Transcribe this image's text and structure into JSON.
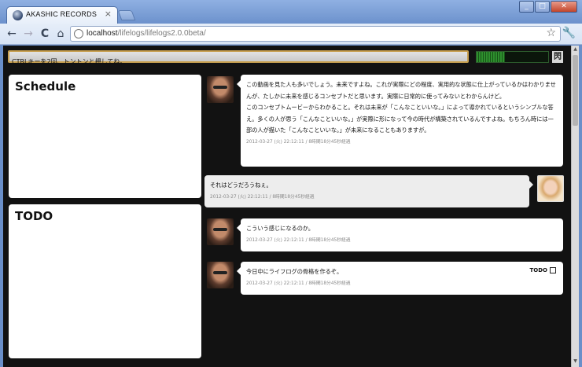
{
  "browser": {
    "tab_title": "AKASHIC RECORDS",
    "tab_close": "×",
    "url_host": "localhost",
    "url_path": "/lifelogs/lifelogs2.0.0beta/",
    "back_icon": "←",
    "forward_icon": "→",
    "reload_icon": "C",
    "home_icon": "⌂",
    "star_icon": "☆",
    "wrench_icon": "🔧",
    "min_icon": "_",
    "max_icon": "□",
    "close_icon": "✕"
  },
  "command_bar": {
    "value": "CTRLキーを2回、トントンと押してね。"
  },
  "meter": {
    "level": 0.4,
    "icon": "閃"
  },
  "schedule": {
    "title": "Schedule"
  },
  "todo": {
    "title": "TODO"
  },
  "messages": [
    {
      "text": "この動画を見た人も多いでしょう。未来ですよね。これが実際にどの程度、実用的な状態に仕上がっているかはわかりませんが、たしかに未来を感じるコンセプトだと思います。実際に日常的に使ってみないとわからんけど。\nこのコンセプトムービーからわかること。それは未来が「こんなこといいな。」によって導かれているというシンプルな答え。多くの人が思う「こんなこといいな。」が実際に形になって今の時代が構築されているんですよね。もちろん時には一部の人が描いた「こんなこといいな。」が未来になることもありますが。",
      "meta": "2012-03-27 (火) 22:12:11 / 8時間18分45秒経過"
    },
    {
      "text": "それはどうだろうねぇ。",
      "meta": "2012-03-27 (火) 22:12:11 / 8時間18分45秒経過"
    },
    {
      "text": "こういう感じになるのか。",
      "meta": "2012-03-27 (火) 22:12:11 / 8時間18分45秒経過"
    },
    {
      "text": "今日中にライフログの骨格を作るぞ。",
      "meta": "2012-03-27 (火) 22:12:11 / 8時間18分45秒経過",
      "tag": "TODO"
    }
  ],
  "colors": {
    "page_bg": "#121212",
    "accent_border": "#c8a050",
    "meter_green": "#2e8f2e"
  }
}
